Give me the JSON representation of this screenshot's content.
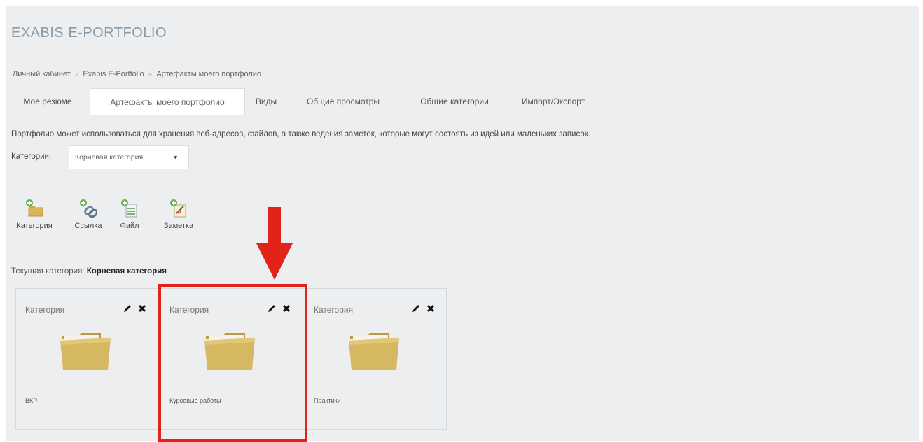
{
  "app": {
    "title": "EXABIS E-PORTFOLIO"
  },
  "breadcrumb": {
    "items": [
      "Личный кабинет",
      "Exabis E-Portfolio",
      "Артефакты моего портфолио"
    ],
    "separator": "»"
  },
  "tabs": [
    {
      "label": "Мое резюме",
      "active": false
    },
    {
      "label": "Артефакты моего портфолио",
      "active": true
    },
    {
      "label": "Виды",
      "active": false
    },
    {
      "label": "Общие просмотры",
      "active": false
    },
    {
      "label": "Общие категории",
      "active": false
    },
    {
      "label": "Импорт/Экспорт",
      "active": false
    }
  ],
  "description": "Портфолио может использоваться для хранения веб-адресов, файлов, а также ведения заметок, которые могут состоять из идей или маленьких записок.",
  "category_filter": {
    "label": "Категории:",
    "selected": "Корневая категория"
  },
  "toolbar": [
    {
      "label": "Категория",
      "icon": "add-category-icon"
    },
    {
      "label": "Ссылка",
      "icon": "add-link-icon"
    },
    {
      "label": "Файл",
      "icon": "add-file-icon"
    },
    {
      "label": "Заметка",
      "icon": "add-note-icon"
    }
  ],
  "current_category": {
    "label": "Текущая категория:",
    "value": "Корневая категория"
  },
  "cards": [
    {
      "type_label": "Категория",
      "name": "ВКР"
    },
    {
      "type_label": "Категория",
      "name": "Курсовые работы"
    },
    {
      "type_label": "Категория",
      "name": "Практики"
    }
  ],
  "colors": {
    "highlight": "#e2231a",
    "folder": "#d2b35c",
    "title": "#8a9aa6"
  }
}
